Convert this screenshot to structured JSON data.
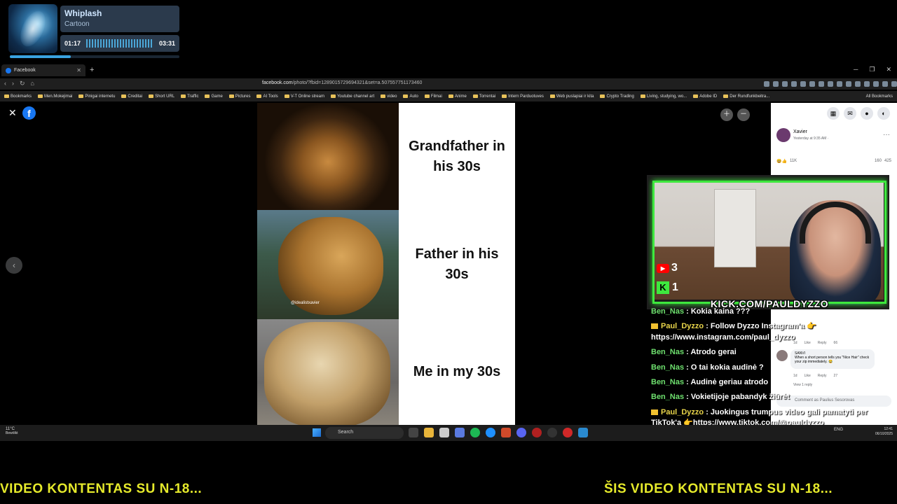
{
  "music": {
    "title": "Whiplash",
    "artist": "Cartoon",
    "elapsed": "01:17",
    "total": "03:31",
    "progress": 0.36
  },
  "browser": {
    "tab_title": "Facebook",
    "url_host": "facebook.com",
    "url_path": "/photo/?fbid=1289015729694321&set=a.507557751173460",
    "bookmarks": [
      "Bookmarks",
      "Men.Mokejimai",
      "Pinigai internetu",
      "Creditai",
      "Short URL",
      "Traffic",
      "Game",
      "Pictures",
      "AI Tools",
      "V-T Online stream",
      "Youtube channel art",
      "video",
      "Auto",
      "Filmai",
      "Anime",
      "Torrentai",
      "Intern Parduotuves",
      "Web puslapiai ir kita",
      "Crypto Trading",
      "Living, studying, wo...",
      "Adobe ID",
      "Der Rundfunkbeitra..."
    ],
    "all_bookmarks": "All Bookmarks"
  },
  "meme": {
    "rows": [
      {
        "caption": "Grandfather in his 30s",
        "watermark": ""
      },
      {
        "caption": "Father in his 30s",
        "watermark": "@idealistxavier"
      },
      {
        "caption": "Me in my 30s",
        "watermark": ""
      }
    ]
  },
  "fb_panel": {
    "poster_name": "Xavier",
    "post_time": "Yesterday at 9:35 AM · ",
    "reactions_count": "11K",
    "comments_count": "160",
    "shares_count": "425",
    "replies_meta": [
      "1d",
      "Like",
      "Reply",
      "66"
    ],
    "commenter": "SANVI",
    "comment_text": "When a short person tells you \"Nice Hair\" check your zip immediately. 😂",
    "comment_meta": [
      "1d",
      "Like",
      "Reply",
      "27"
    ],
    "view_reply": "View 1 reply",
    "comment_placeholder": "Comment as Paulius Sesorovas"
  },
  "stream": {
    "youtube_viewers": "3",
    "kick_viewers": "1",
    "banner": "KICK.COM/PAULDYZZO"
  },
  "chat": [
    {
      "user": "Ben_Nas",
      "text": "Kokia kaina ???",
      "mod": false
    },
    {
      "user": "Paul_Dyzzo",
      "text": "Follow Dyzzo Instagram'a 👉 https://www.instagram.com/paul_dyzzo",
      "mod": true
    },
    {
      "user": "Ben_Nas",
      "text": "Atrodo gerai",
      "mod": false
    },
    {
      "user": "Ben_Nas",
      "text": "O tai kokia audinė ?",
      "mod": false
    },
    {
      "user": "Ben_Nas",
      "text": "Audinė geriau atrodo",
      "mod": false
    },
    {
      "user": "Ben_Nas",
      "text": "Vokietijoje pabandyk žiūrėt",
      "mod": false
    },
    {
      "user": "Paul_Dyzzo",
      "text": "Juokingus trumpus video gali pamatyti per TikTok'ą 👉https://www.tiktok.com/@pauldyzzo",
      "mod": true
    }
  ],
  "taskbar": {
    "temp": "11°C",
    "weather": "Bewölkt",
    "search": "Search",
    "lang": "ENG",
    "time": "12:41",
    "date": "06/10/2025"
  },
  "banners": {
    "left": "VIDEO KONTENTAS SU N-18...",
    "right": "ŠIS VIDEO KONTENTAS SU N-18..."
  }
}
